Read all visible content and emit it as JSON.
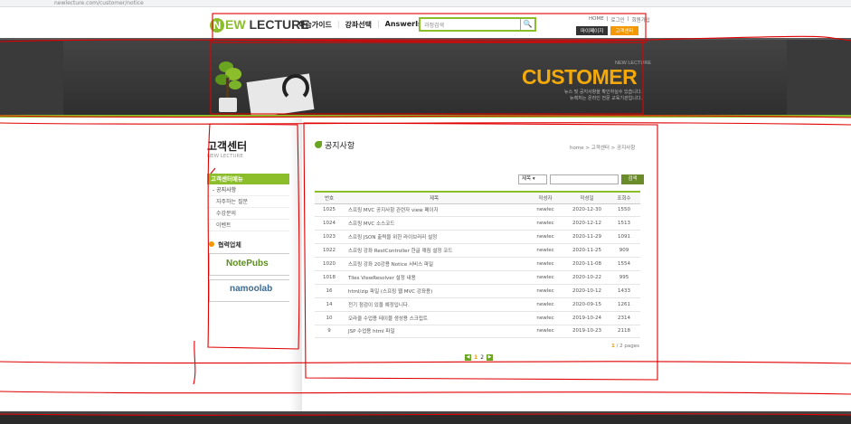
{
  "browser": {
    "url": "newlecture.com/customer/notice"
  },
  "header": {
    "logo_mark": "N",
    "logo_ew": "EW",
    "logo_text": "LECTURE",
    "nav": [
      "학습가이드",
      "강좌선택",
      "AnswerIs"
    ],
    "search_placeholder": "과정검색",
    "util_links": [
      "HOME",
      "로그인",
      "회원가입"
    ],
    "mypage_label": "마이페이지",
    "customer_label": "고객센터"
  },
  "banner": {
    "sub": "NEW LECTURE",
    "title": "CUSTOMER",
    "desc1": "뉴스 및 공지사항을 확인하실수 있습니다.",
    "desc2": "뉴렉처는 온라인 전문 교육기관입니다."
  },
  "sidebar": {
    "title": "고객센터",
    "subtitle": "NEW LECTURE",
    "menu_head": "고객센터메뉴",
    "items": [
      "공지사항",
      "자주하는 질문",
      "수강문의",
      "이벤트"
    ],
    "partner_title": "협력업체",
    "partners": [
      "NotePubs",
      "namoolab"
    ]
  },
  "main": {
    "title": "공지사항",
    "breadcrumb": "home > 고객센터 > 공지사항",
    "search_select": "제목",
    "search_button": "검색",
    "columns": [
      "번호",
      "제목",
      "작성자",
      "작성일",
      "조회수"
    ],
    "rows": [
      [
        "1025",
        "스프링 MVC 공지사항 관련자 view 페이지",
        "newlec",
        "2020-12-30",
        "1550"
      ],
      [
        "1024",
        "스프링 MVC 소스코드",
        "newlec",
        "2020-12-12",
        "1513"
      ],
      [
        "1023",
        "스프링 JSON 출력을 위한 라이브러리 설정",
        "newlec",
        "2020-11-29",
        "1091"
      ],
      [
        "1022",
        "스프링 강좌 RestController 한글 깨짐 설정 코드",
        "newlec",
        "2020-11-25",
        "909"
      ],
      [
        "1020",
        "스프링 강좌 20강용 Notice 서비스 파일",
        "newlec",
        "2020-11-08",
        "1554"
      ],
      [
        "1018",
        "Tiles ViewResolver 설정 내용",
        "newlec",
        "2020-10-22",
        "995"
      ],
      [
        "16",
        "html/zip 파일 (스프링 웹 MVC 강좌용)",
        "newlec",
        "2020-10-12",
        "1433"
      ],
      [
        "14",
        "전기 점검이 있을 예정입니다.",
        "newlec",
        "2020-09-15",
        "1261"
      ],
      [
        "10",
        "오라클 수업용 테이블 생성용 스크립트",
        "newlec",
        "2019-10-24",
        "2314"
      ],
      [
        "9",
        "JSP 수업용 html 파일",
        "newlec",
        "2019-10-23",
        "2118"
      ]
    ],
    "page_current": "1",
    "page_info_rest": "/ 2 pages",
    "pages": [
      "1",
      "2"
    ]
  },
  "colors": {
    "accent": "#8cbd2a",
    "orange": "#f39800",
    "annotation": "#e00000"
  }
}
